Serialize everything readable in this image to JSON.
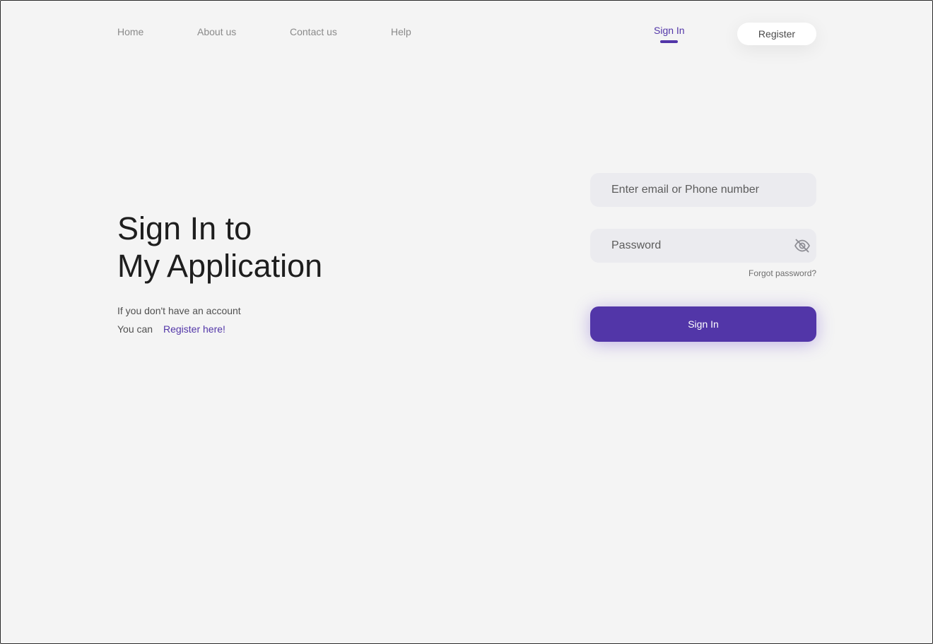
{
  "nav": {
    "links": [
      "Home",
      "About us",
      "Contact us",
      "Help"
    ],
    "signin_label": "Sign In",
    "register_label": "Register"
  },
  "hero": {
    "title_line1": "Sign In to",
    "title_line2": "My Application",
    "no_account_text": "If you don't have an account",
    "you_can_text": "You can",
    "register_link": "Register here!"
  },
  "form": {
    "email_placeholder": "Enter email or Phone number",
    "email_value": "",
    "password_placeholder": "Password",
    "password_value": "",
    "forgot_label": "Forgot password?",
    "submit_label": "Sign In",
    "password_toggle_icon": "eye-slash-icon"
  },
  "colors": {
    "accent": "#5236a8",
    "background": "#f4f4f4",
    "field_background": "#ebebef"
  }
}
